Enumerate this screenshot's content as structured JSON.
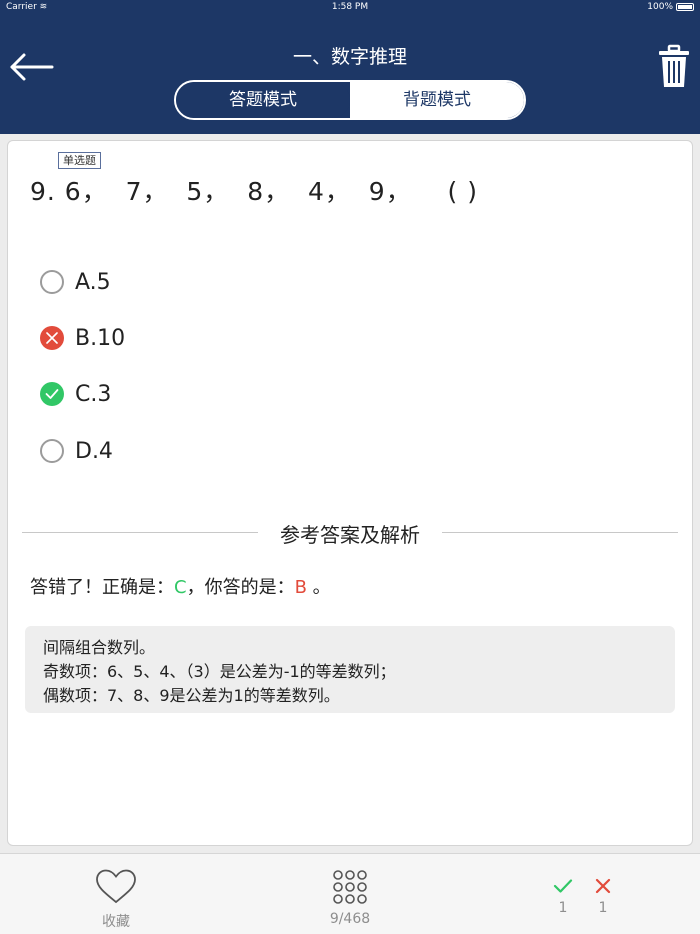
{
  "status_bar": {
    "carrier": "Carrier",
    "time": "1:58 PM",
    "battery": "100%"
  },
  "header": {
    "title": "一、数字推理",
    "mode_answer": "答题模式",
    "mode_memorize": "背题模式"
  },
  "question": {
    "type": "单选题",
    "text": "9. 6，  7，  5，  8，  4，  9，    ( )",
    "options": [
      {
        "label": "A.5",
        "state": "unselected"
      },
      {
        "label": "B.10",
        "state": "wrong"
      },
      {
        "label": "C.3",
        "state": "correct"
      },
      {
        "label": "D.4",
        "state": "unselected"
      }
    ]
  },
  "analysis": {
    "title": "参考答案及解析",
    "result_prefix": "答错了！正确是：",
    "correct_answer": "C",
    "result_mid": "，你答的是：",
    "your_answer": "B",
    "result_suffix": " 。",
    "explanation": [
      "间隔组合数列。",
      "奇数项：6、5、4、（3）是公差为-1的等差数列；",
      "偶数项：7、8、9是公差为1的等差数列。"
    ]
  },
  "tabbar": {
    "favorite_label": "收藏",
    "progress_label": "9/468",
    "correct_count": "1",
    "wrong_count": "1"
  },
  "colors": {
    "nav": "#1d3766",
    "correct": "#31c766",
    "wrong": "#e24b3b"
  }
}
